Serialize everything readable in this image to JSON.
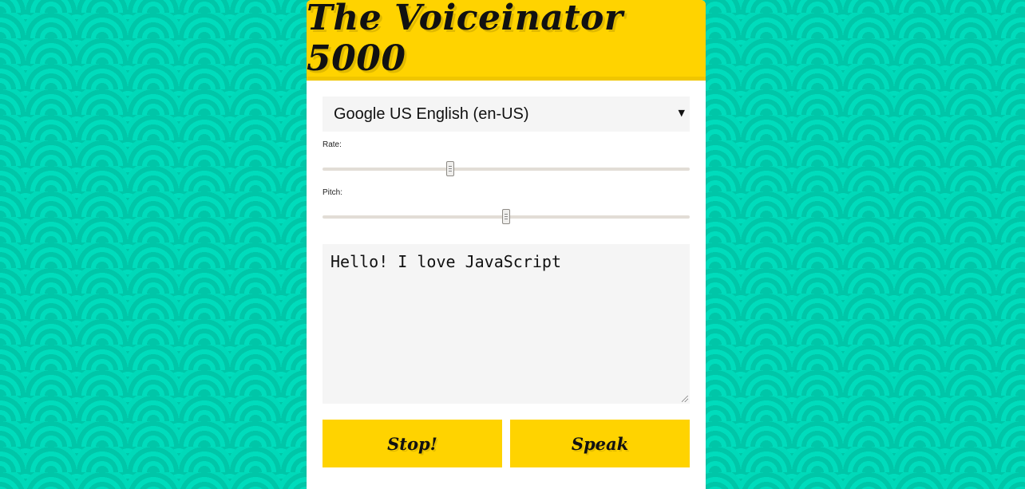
{
  "app": {
    "title": "The Voiceinator 5000"
  },
  "voice_select": {
    "selected": "Google US English (en-US)",
    "arrow_icon": "triangle-down-icon"
  },
  "rate": {
    "label": "Rate:",
    "value_fraction": 0.345
  },
  "pitch": {
    "label": "Pitch:",
    "value_fraction": 0.5
  },
  "message": {
    "text": "Hello! I love JavaScript"
  },
  "buttons": {
    "stop_label": "Stop!",
    "speak_label": "Speak"
  },
  "colors": {
    "background": "#00d4b4",
    "accent": "#ffd300",
    "panel": "#ffffff",
    "field": "#f5f5f5"
  }
}
